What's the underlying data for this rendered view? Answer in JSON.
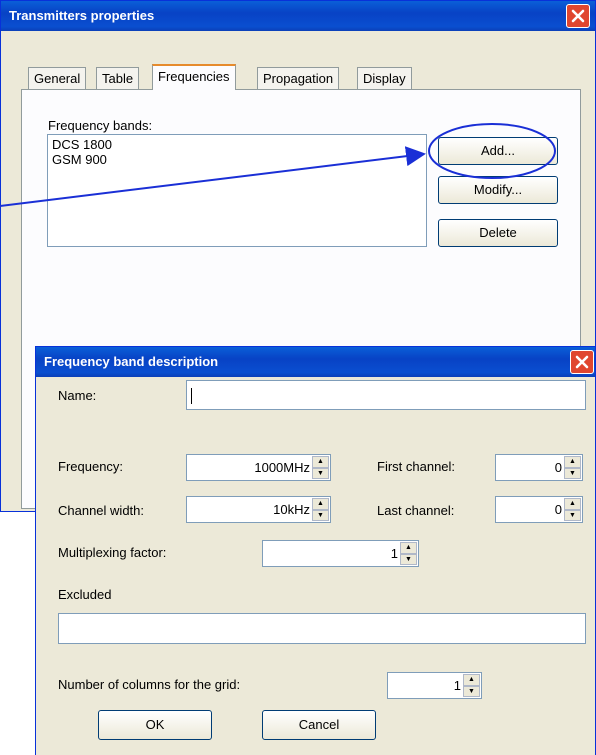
{
  "transmitters_dialog": {
    "title": "Transmitters properties",
    "tabs": [
      {
        "label": "General",
        "active": false
      },
      {
        "label": "Table",
        "active": false
      },
      {
        "label": "Frequencies",
        "active": true
      },
      {
        "label": "Propagation",
        "active": false
      },
      {
        "label": "Display",
        "active": false
      }
    ],
    "bands_label": "Frequency bands:",
    "bands": [
      "DCS 1800",
      "GSM 900"
    ],
    "add_label": "Add...",
    "modify_label": "Modify...",
    "delete_label": "Delete"
  },
  "band_dialog": {
    "title": "Frequency band description",
    "name_label": "Name:",
    "name_value": "",
    "frequency_label": "Frequency:",
    "frequency_value": "1000MHz",
    "channel_width_label": "Channel width:",
    "channel_width_value": "10kHz",
    "first_channel_label": "First channel:",
    "first_channel_value": "0",
    "last_channel_label": "Last channel:",
    "last_channel_value": "0",
    "multiplexing_label": "Multiplexing factor:",
    "multiplexing_value": "1",
    "excluded_label": "Excluded",
    "excluded_value": "",
    "columns_label": "Number of columns for the grid:",
    "columns_value": "1",
    "ok_label": "OK",
    "cancel_label": "Cancel"
  },
  "colors": {
    "titlebar": "#0a4fd0",
    "annotation": "#1a2fd6",
    "close": "#e0462f"
  }
}
